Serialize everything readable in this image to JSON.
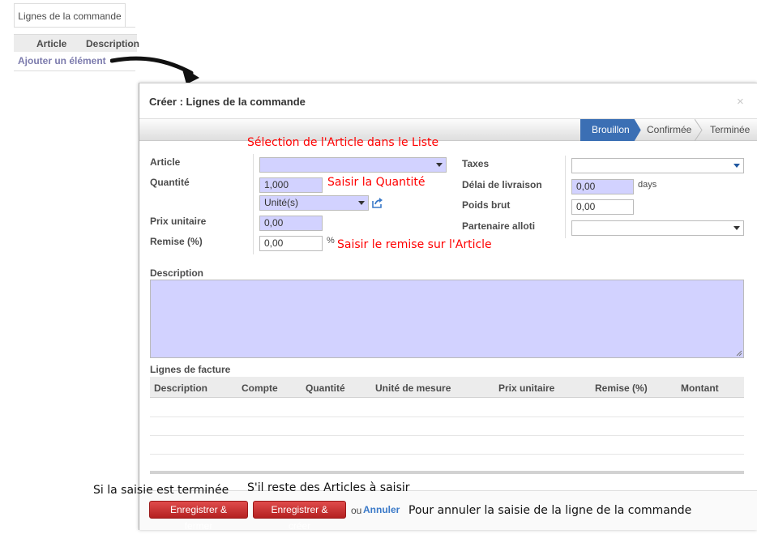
{
  "background": {
    "tab_label": "Lignes de la commande",
    "columns": [
      "Article",
      "Description"
    ],
    "add_item": "Ajouter un élément"
  },
  "dialog": {
    "title": "Créer : Lignes de la commande",
    "close_icon": "×",
    "statuses": [
      "Brouillon",
      "Confirmée",
      "Terminée"
    ],
    "active_status": "Brouillon"
  },
  "form": {
    "article_label": "Article",
    "article_value": "",
    "quantity_label": "Quantité",
    "quantity_value": "1,000",
    "uom_value": "Unité(s)",
    "unit_price_label": "Prix unitaire",
    "unit_price_value": "0,00",
    "discount_label": "Remise (%)",
    "discount_value": "0,00",
    "discount_unit": "%",
    "taxes_label": "Taxes",
    "taxes_value": "",
    "delay_label": "Délai de livraison",
    "delay_value": "0,00",
    "delay_unit": "days",
    "gross_weight_label": "Poids brut",
    "gross_weight_value": "0,00",
    "partner_label": "Partenaire alloti",
    "partner_value": "",
    "description_label": "Description",
    "description_value": ""
  },
  "invoice_lines": {
    "title": "Lignes de facture",
    "columns": [
      "Description",
      "Compte",
      "Quantité",
      "Unité de mesure",
      "Prix unitaire",
      "Remise (%)",
      "Montant"
    ]
  },
  "annotations": {
    "article": "Sélection de l'Article dans le Liste",
    "quantity": "Saisir la Quantité",
    "discount": "Saisir le remise sur l'Article",
    "finished": "Si la saisie est terminée",
    "more_articles": "S'il reste des Articles à saisir",
    "cancel": "Pour annuler la saisie de la ligne de  la commande"
  },
  "footer": {
    "save_close": "Enregistrer & fermer",
    "save_create": "Enregistrer & créer",
    "or": "ou",
    "cancel": "Annuler"
  },
  "colors": {
    "required_field": "#d2d2ff",
    "active_status": "#3b6fb4",
    "primary_button": "#c53030",
    "annotation": "#ff0000"
  }
}
